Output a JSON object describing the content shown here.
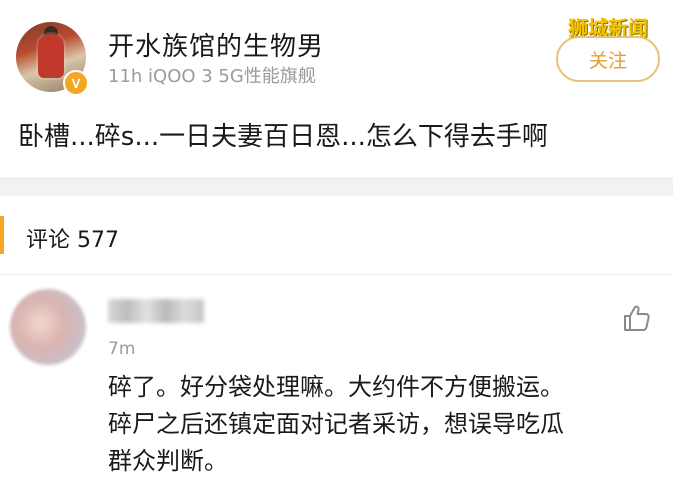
{
  "watermark": "狮城新闻",
  "post": {
    "user_name": "开水族馆的生物男",
    "verified_badge": "V",
    "meta": "11h iQOO 3 5G性能旗舰",
    "follow_label": "关注",
    "text": "卧槽...碎s...一日夫妻百日恩...怎么下得去手啊"
  },
  "comments_section": {
    "label": "评论 577"
  },
  "comment": {
    "time": "7m",
    "like_icon": "thumbs-up-icon",
    "lines": [
      "碎了。好分袋处理嘛。大约件不方便搬运。",
      "碎尸之后还镇定面对记者采访，想误导吃瓜",
      "群众判断。"
    ]
  },
  "colors": {
    "accent": "#f5a623",
    "follow_text": "#e89a2e",
    "meta_gray": "#9b9b9b",
    "divider": "#f2f2f2"
  }
}
